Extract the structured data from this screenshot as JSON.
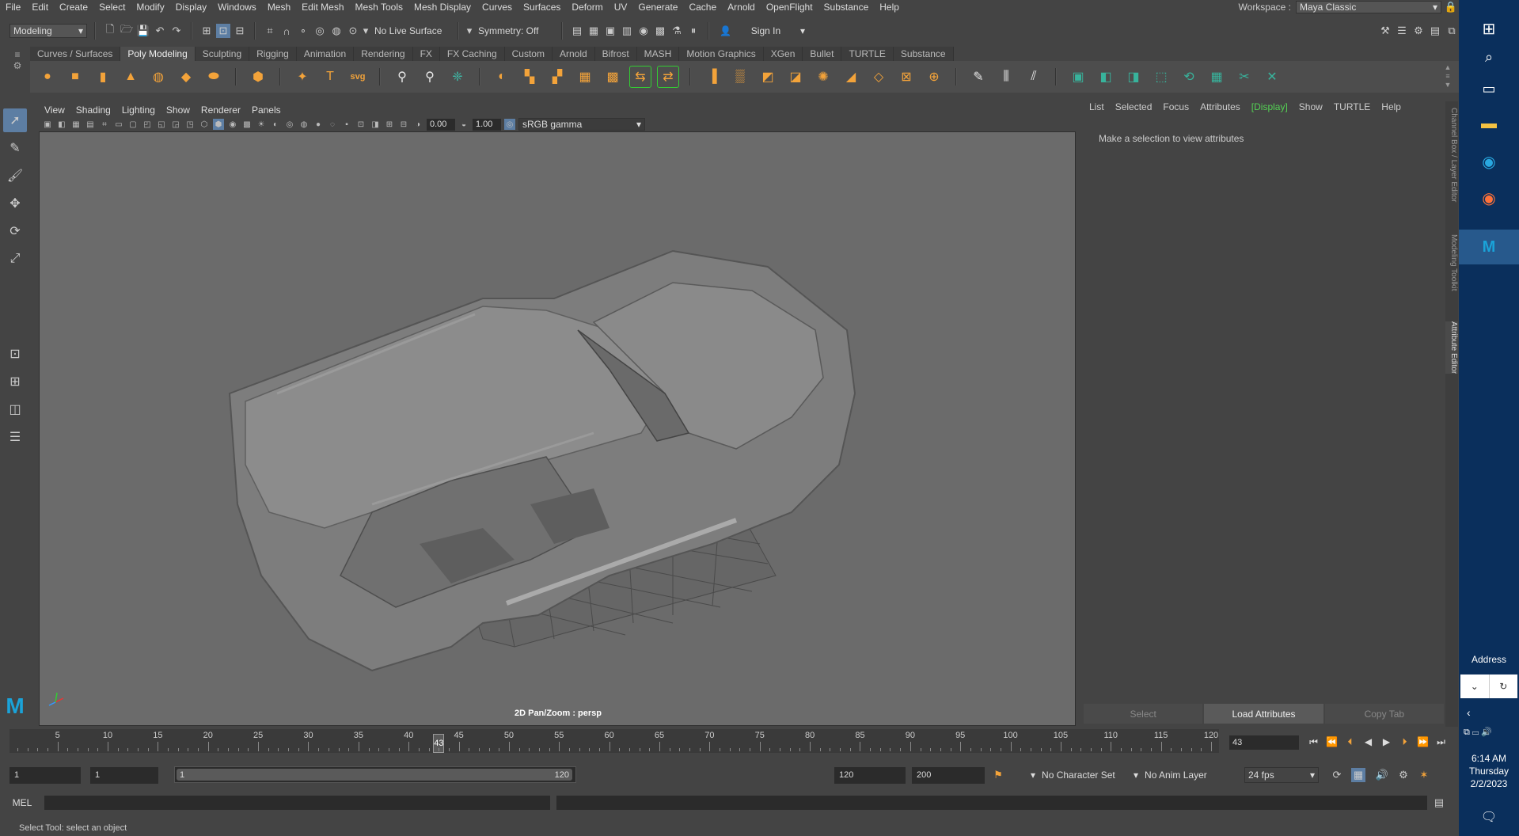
{
  "menubar": {
    "items": [
      "File",
      "Edit",
      "Create",
      "Select",
      "Modify",
      "Display",
      "Windows",
      "Mesh",
      "Edit Mesh",
      "Mesh Tools",
      "Mesh Display",
      "Curves",
      "Surfaces",
      "Deform",
      "UV",
      "Generate",
      "Cache",
      "Arnold",
      "OpenFlight",
      "Substance",
      "Help"
    ],
    "workspace_label": "Workspace :",
    "workspace_value": "Maya Classic"
  },
  "statusline": {
    "mode": "Modeling",
    "live_surface": "No Live Surface",
    "symmetry": "Symmetry: Off",
    "sign_in": "Sign In"
  },
  "shelf": {
    "tabs": [
      "Curves / Surfaces",
      "Poly Modeling",
      "Sculpting",
      "Rigging",
      "Animation",
      "Rendering",
      "FX",
      "FX Caching",
      "Custom",
      "Arnold",
      "Bifrost",
      "MASH",
      "Motion Graphics",
      "XGen",
      "Bullet",
      "TURTLE",
      "Substance"
    ],
    "active_tab": "Poly Modeling",
    "text_icon": "T",
    "svg_icon": "svg"
  },
  "viewport": {
    "menu": [
      "View",
      "Shading",
      "Lighting",
      "Show",
      "Renderer",
      "Panels"
    ],
    "exposure": "0.00",
    "gamma": "1.00",
    "color_space": "sRGB gamma",
    "hud_label": "2D Pan/Zoom : persp"
  },
  "attribute_editor": {
    "menu": [
      "List",
      "Selected",
      "Focus",
      "Attributes",
      "[Display]",
      "Show",
      "TURTLE",
      "Help"
    ],
    "message": "Make a selection to view attributes",
    "buttons": [
      "Select",
      "Load Attributes",
      "Copy Tab"
    ],
    "side_tabs": [
      "Channel Box / Layer Editor",
      "Modeling Toolkit",
      "Attribute Editor"
    ]
  },
  "timeline": {
    "tick_labels": [
      "5",
      "10",
      "15",
      "20",
      "25",
      "30",
      "35",
      "40",
      "45",
      "50",
      "55",
      "60",
      "65",
      "70",
      "75",
      "80",
      "85",
      "90",
      "95",
      "100",
      "105",
      "110",
      "115",
      "120"
    ],
    "current_frame": "43",
    "frame_field": "43"
  },
  "range": {
    "start": "1",
    "playback_start": "1",
    "slider_start": "1",
    "slider_end": "120",
    "playback_end": "120",
    "end": "200",
    "character_set": "No Character Set",
    "anim_layer": "No Anim Layer",
    "fps": "24 fps"
  },
  "command": {
    "label": "MEL",
    "help": "Select Tool: select an object"
  },
  "taskbar": {
    "address_label": "Address",
    "time": "6:14 AM",
    "day": "Thursday",
    "date": "2/2/2023"
  },
  "colors": {
    "panel": "#444444",
    "viewport_bg": "#6b6b6b",
    "shelf_orange": "#f3a33a",
    "shelf_teal": "#38b39c",
    "highlight_green": "#54d154",
    "taskbar": "#0a2f5c"
  }
}
